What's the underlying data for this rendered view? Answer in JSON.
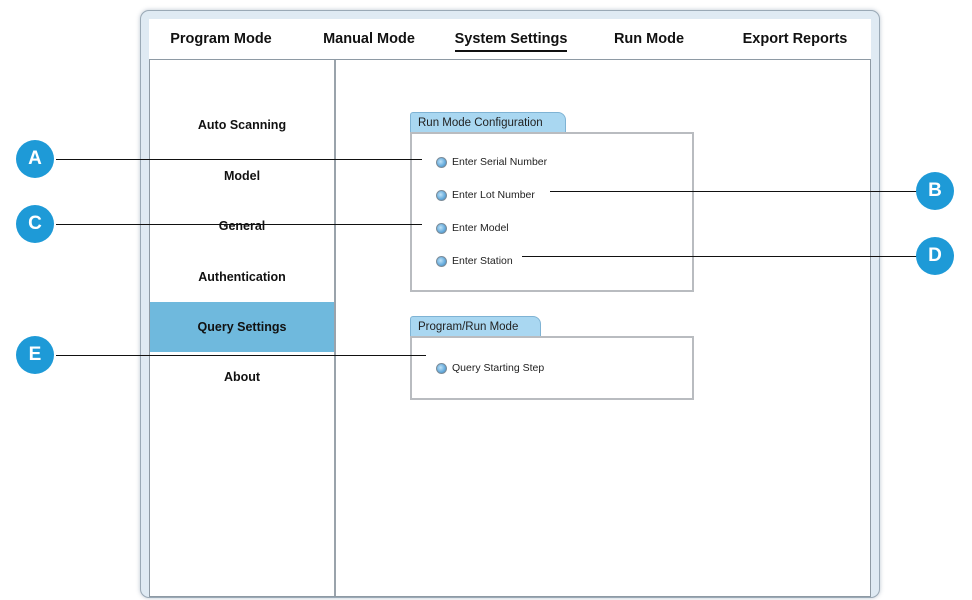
{
  "tabs": [
    {
      "label": "Program Mode",
      "active": false
    },
    {
      "label": "Manual Mode",
      "active": false
    },
    {
      "label": "System Settings",
      "active": true
    },
    {
      "label": "Run Mode",
      "active": false
    },
    {
      "label": "Export Reports",
      "active": false
    }
  ],
  "sidebar": {
    "items": [
      {
        "label": "Auto Scanning"
      },
      {
        "label": "Model"
      },
      {
        "label": "General"
      },
      {
        "label": "Authentication"
      },
      {
        "label": "Query Settings",
        "active": true
      },
      {
        "label": "About"
      }
    ],
    "active_color": "#6fb9dd"
  },
  "run_mode_group": {
    "title": "Run Mode Configuration",
    "options": [
      {
        "label": "Enter Serial Number"
      },
      {
        "label": "Enter Lot Number"
      },
      {
        "label": "Enter Model"
      },
      {
        "label": "Enter Station"
      }
    ]
  },
  "program_run_group": {
    "title": "Program/Run Mode",
    "options": [
      {
        "label": "Query Starting Step"
      }
    ]
  },
  "callouts": {
    "a": "A",
    "b": "B",
    "c": "C",
    "d": "D",
    "e": "E",
    "color": "#1e9ad7"
  }
}
